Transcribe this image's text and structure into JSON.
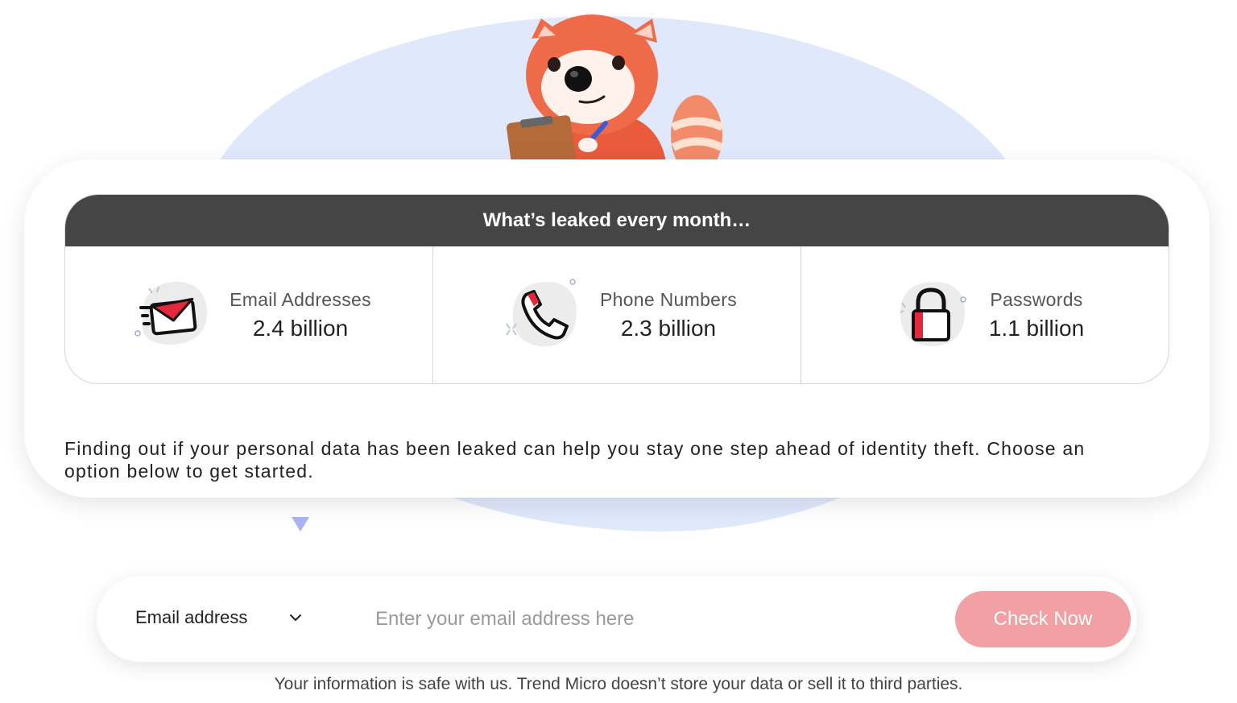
{
  "colors": {
    "header_bg": "#454545",
    "accent_red": "#e2283a",
    "button_bg": "#f1a0a3",
    "blob_bg": "#dfe9fb",
    "pointer": "#a9b3f3"
  },
  "stats": {
    "title": "What’s leaked every month…",
    "items": [
      {
        "label": "Email Addresses",
        "value": "2.4 billion",
        "icon": "envelope-icon"
      },
      {
        "label": "Phone Numbers",
        "value": "2.3 billion",
        "icon": "phone-icon"
      },
      {
        "label": "Passwords",
        "value": "1.1 billion",
        "icon": "lock-icon"
      }
    ]
  },
  "description": "Finding out if your personal data has been leaked can help you stay one step ahead of identity theft. Choose an option below to get started.",
  "search": {
    "selected_type": "Email address",
    "placeholder": "Enter your email address here",
    "button_label": "Check Now"
  },
  "privacy_note": "Your information is safe with us. Trend Micro doesn’t store your data or sell it to third parties."
}
